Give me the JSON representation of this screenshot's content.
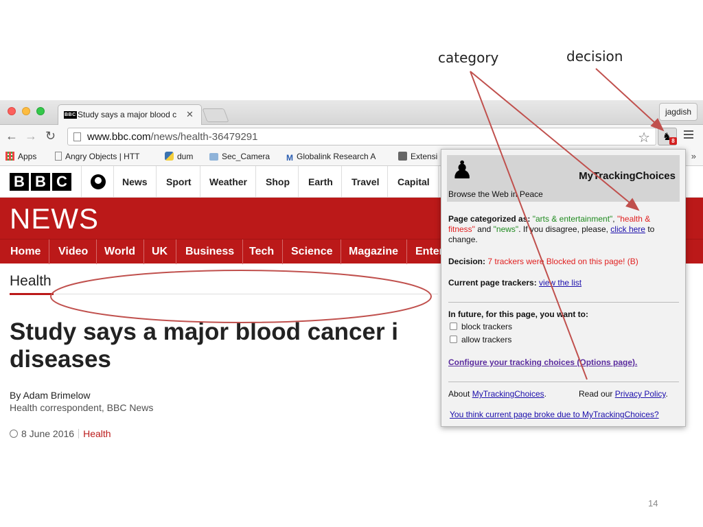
{
  "annotations": {
    "category": "category",
    "decision": "decision",
    "slide_number": "14"
  },
  "browser": {
    "tab_title": "Study says a major blood c",
    "tab_favicon": "BBC",
    "profile_name": "jagdish",
    "url_host": "www.bbc.com",
    "url_path": "/news/health-36479291",
    "extension_badge": "8",
    "bookmarks": [
      {
        "label": "Apps",
        "icon": "apps-grid-icon"
      },
      {
        "label": "Angry Objects | HTT",
        "icon": "page-icon"
      },
      {
        "label": "dum",
        "icon": "python-icon"
      },
      {
        "label": "Sec_Camera",
        "icon": "folder-icon"
      },
      {
        "label": "Globalink Research A",
        "icon": "globalink-icon"
      },
      {
        "label": "Extensi",
        "icon": "puzzle-icon"
      }
    ],
    "bookmarks_more": "»"
  },
  "bbc": {
    "logo_letters": [
      "B",
      "B",
      "C"
    ],
    "topnav": [
      "News",
      "Sport",
      "Weather",
      "Shop",
      "Earth",
      "Travel",
      "Capital"
    ],
    "banner": "NEWS",
    "newsnav": [
      "Home",
      "Video",
      "World",
      "UK",
      "Business",
      "Tech",
      "Science",
      "Magazine",
      "Enter"
    ],
    "section": "Health",
    "headline_line1": "Study says a major blood cancer i",
    "headline_line2": "diseases",
    "author": "By Adam Brimelow",
    "author_role": "Health correspondent, BBC News",
    "date": "8 June 2016",
    "date_section": "Health"
  },
  "popup": {
    "brand": "MyTrackingChoices",
    "tagline": "Browse the Web in Peace",
    "category_label": "Page categorized as: ",
    "cat1": "\"arts & entertainment\"",
    "sep1": ", ",
    "cat2": "\"health & fitness\"",
    "and": " and ",
    "cat3": "\"news\"",
    "disagree": ". If you disagree, please, ",
    "click_here": "click here",
    "to_change": " to change.",
    "decision_label": "Decision: ",
    "decision_value": "7 trackers were Blocked on this page! (B)",
    "trackers_label": "Current page trackers: ",
    "view_list": "view the list",
    "future": "In future, for this page, you want to:",
    "opt_block": "block trackers",
    "opt_allow": "allow trackers",
    "configure": "Configure your tracking choices (Options page).",
    "about_prefix": "About ",
    "about_link": "MyTrackingChoices",
    "about_suffix": ".",
    "read_our": "Read our ",
    "privacy": "Privacy Policy",
    "privacy_suffix": ".",
    "broke": "You think current page broke due to MyTrackingChoices?"
  },
  "colors": {
    "bbc_red": "#bb1919",
    "annotation_line": "#c0504d"
  }
}
